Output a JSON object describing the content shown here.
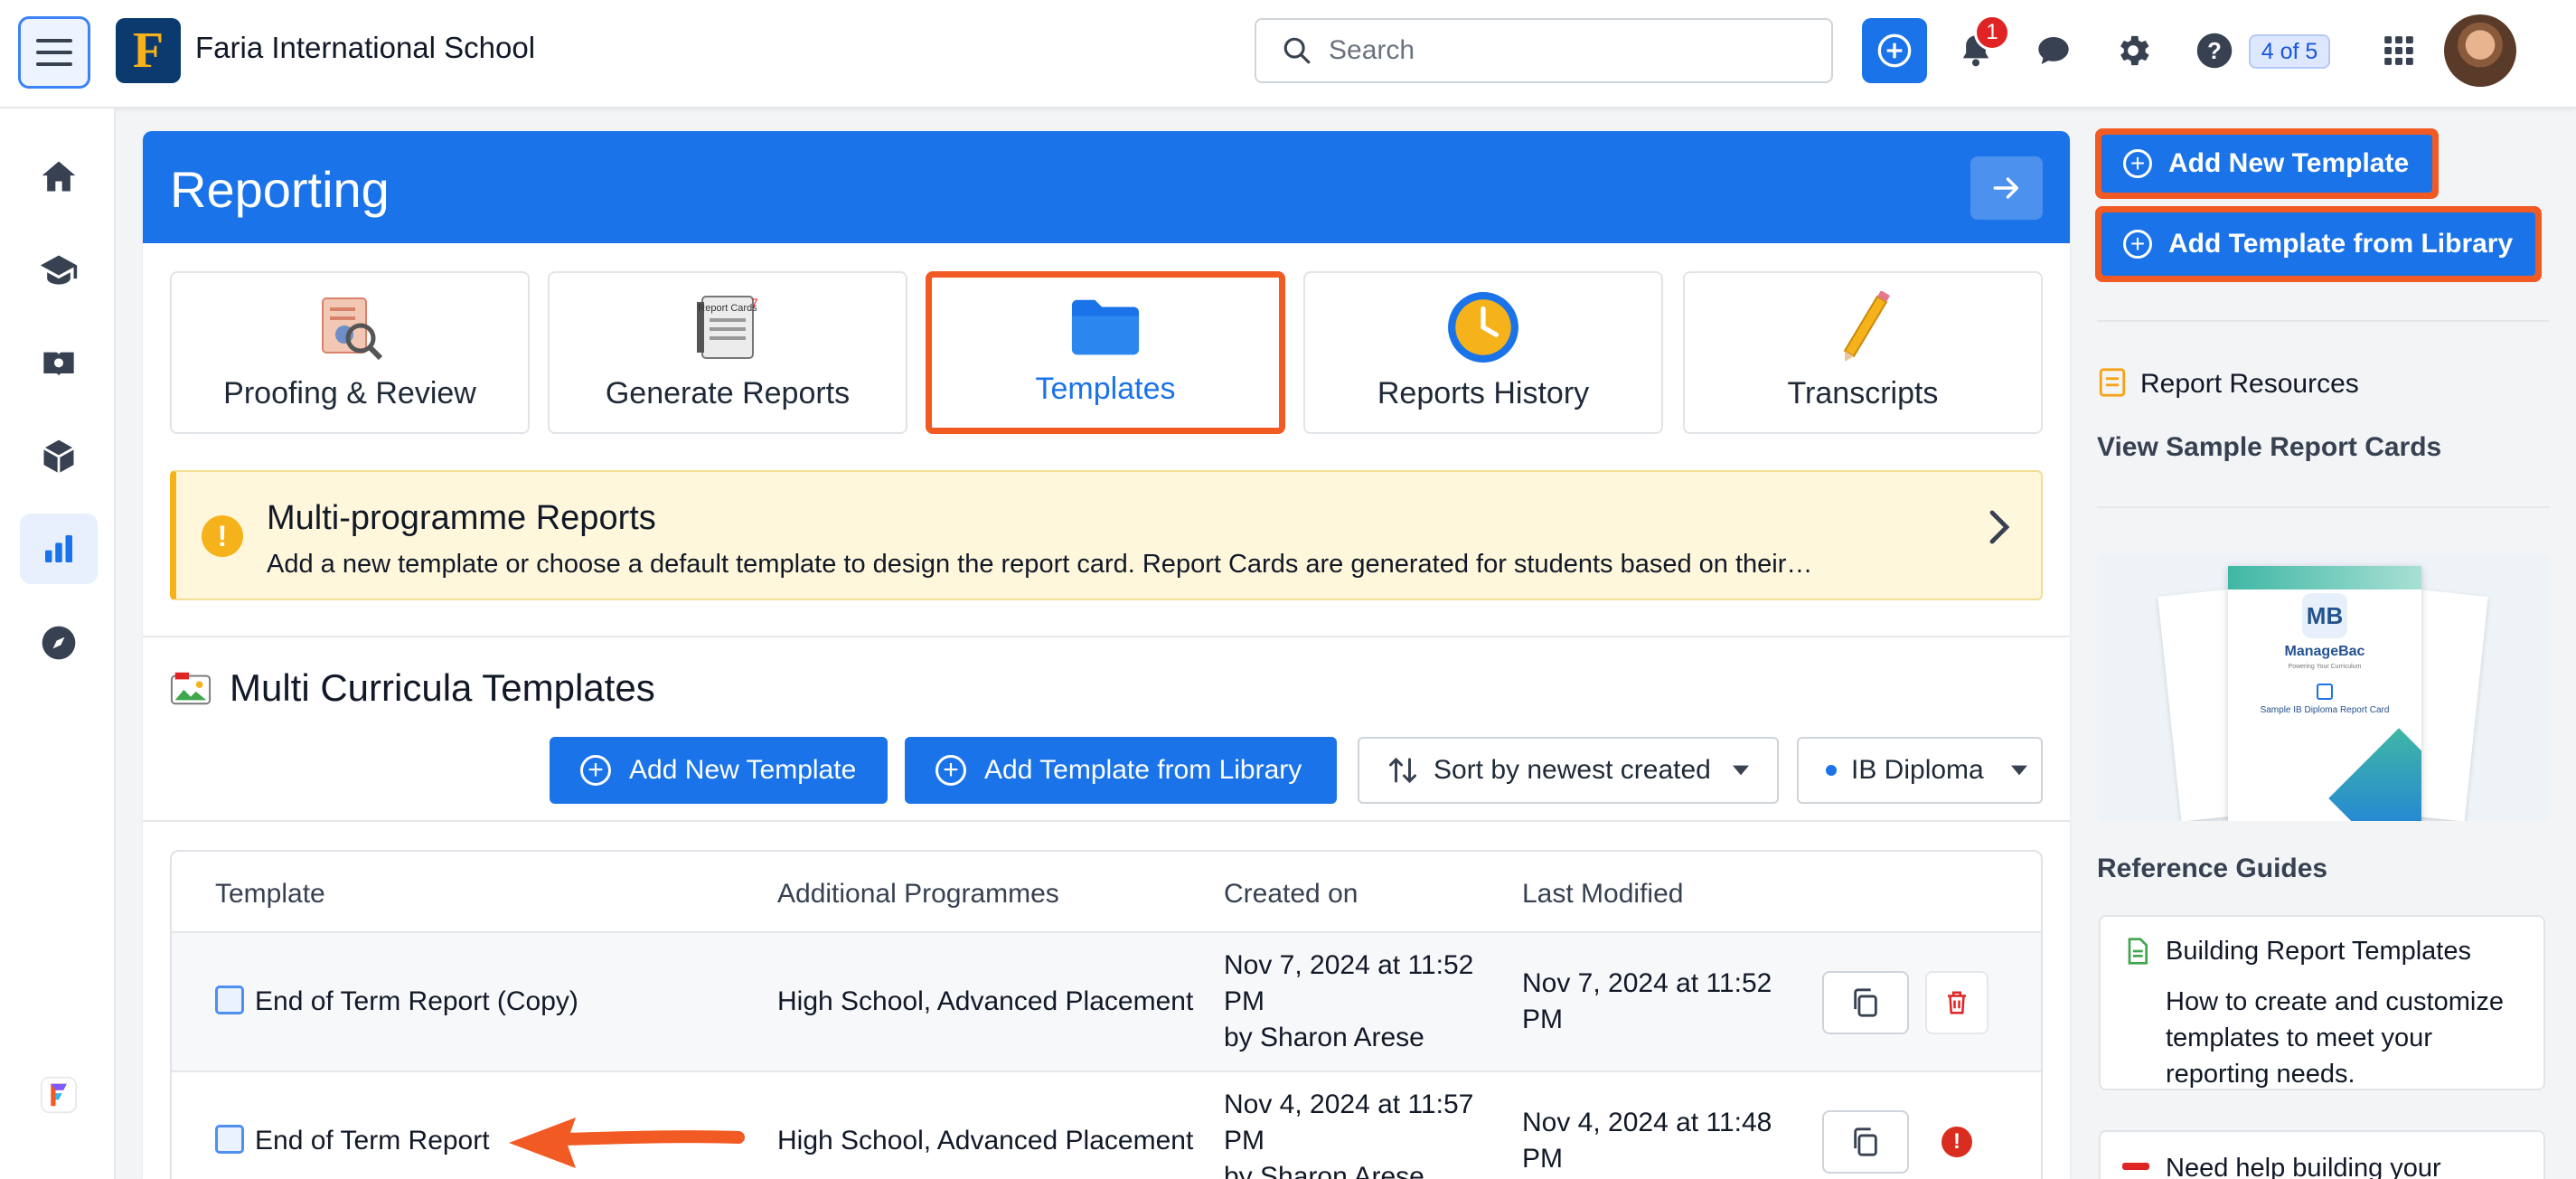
{
  "topbar": {
    "school_name": "Faria International School",
    "logo_letter": "F",
    "search_placeholder": "Search",
    "notification_count": "1",
    "pager": "4 of 5"
  },
  "main": {
    "title": "Reporting",
    "cards": [
      {
        "label": "Proofing & Review",
        "icon": "proofing-icon"
      },
      {
        "label": "Generate Reports",
        "icon": "report-cards-icon",
        "icon_text": "Report Cards"
      },
      {
        "label": "Templates",
        "icon": "folder-icon",
        "selected": true
      },
      {
        "label": "Reports History",
        "icon": "clock-icon"
      },
      {
        "label": "Transcripts",
        "icon": "pencil-icon"
      }
    ],
    "notice": {
      "title": "Multi-programme Reports",
      "text": "Add a new template or choose a default template to design the report card. Report Cards are generated for students based on their…"
    },
    "section_title": "Multi Curricula Templates",
    "buttons": {
      "add_new": "Add New Template",
      "add_library": "Add Template from Library",
      "sort": "Sort by newest created",
      "programme": "IB Diploma"
    },
    "table": {
      "headers": [
        "Template",
        "Additional Programmes",
        "Created on",
        "Last Modified"
      ],
      "rows": [
        {
          "template": "End of Term Report (Copy)",
          "programmes": "High School, Advanced Placement",
          "created": "Nov 7, 2024 at 11:52 PM",
          "created_by": "by Sharon Arese",
          "modified": "Nov 7, 2024 at 11:52 PM"
        },
        {
          "template": "End of Term Report",
          "programmes": "High School, Advanced Placement",
          "created": "Nov 4, 2024 at 11:57 PM",
          "created_by": "by Sharon Arese",
          "modified": "Nov 4, 2024 at 11:48 PM"
        }
      ]
    }
  },
  "sidebar": {
    "add_new": "Add New Template",
    "add_library": "Add Template from Library",
    "resources_title": "Report Resources",
    "view_sample": "View Sample Report Cards",
    "thumb": {
      "brand": "ManageBac",
      "tagline": "Powering Your Curriculum",
      "caption": "Sample IB Diploma Report Card"
    },
    "guides_title": "Reference Guides",
    "guides": [
      {
        "title": "Building Report Templates",
        "text": "How to create and customize templates to meet your reporting needs."
      },
      {
        "title": "Need help building your"
      }
    ]
  },
  "colors": {
    "brand_blue": "#1a73e8",
    "highlight_orange": "#f15a22",
    "notice_yellow": "#f6b21a",
    "error_red": "#d92d20"
  }
}
